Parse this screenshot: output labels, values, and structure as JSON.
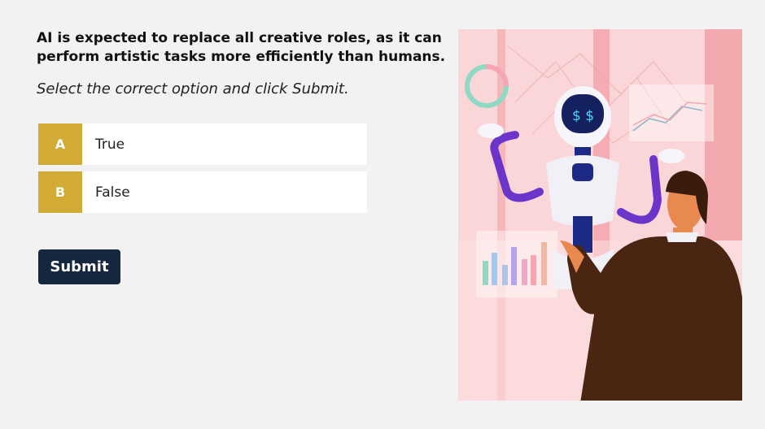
{
  "question": "AI is expected to replace all creative roles, as it can perform artistic tasks more efficiently than humans.",
  "instruction": "Select the correct option and click Submit.",
  "options": [
    {
      "letter": "A",
      "label": "True"
    },
    {
      "letter": "B",
      "label": "False"
    }
  ],
  "submit_label": "Submit",
  "colors": {
    "background": "#f2f2f2",
    "option_letter_bg": "#d1ab36",
    "submit_bg": "#14273f",
    "illustration_bg": "#f9d3d6"
  },
  "illustration": {
    "description_icon": "robot-and-man-illustration"
  }
}
